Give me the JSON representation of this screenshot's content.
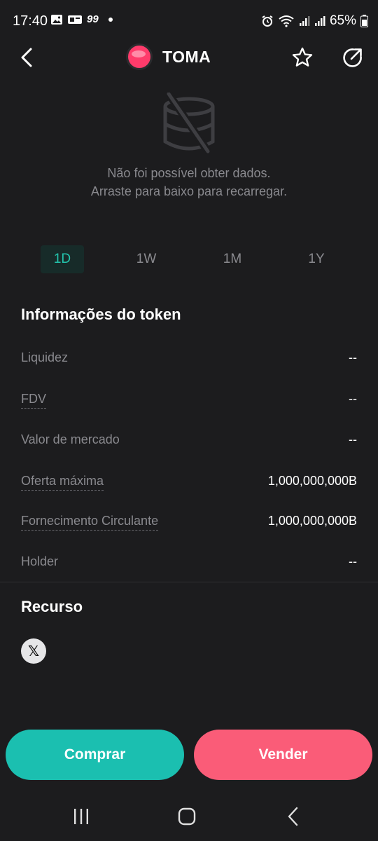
{
  "status_bar": {
    "time": "17:40",
    "badge": "99",
    "battery": "65%"
  },
  "header": {
    "token_name": "TOMA",
    "accent_color": "#ff3b6b"
  },
  "empty_state": {
    "line1": "Não foi possível obter dados.",
    "line2": "Arraste para baixo para recarregar."
  },
  "period_tabs": [
    {
      "label": "1D",
      "active": true
    },
    {
      "label": "1W",
      "active": false
    },
    {
      "label": "1M",
      "active": false
    },
    {
      "label": "1Y",
      "active": false
    }
  ],
  "token_info": {
    "title": "Informações do token",
    "rows": [
      {
        "label": "Liquidez",
        "value": "--"
      },
      {
        "label": "FDV",
        "value": "--"
      },
      {
        "label": "Valor de mercado",
        "value": "--"
      },
      {
        "label": "Oferta máxima",
        "value": "1,000,000,000B"
      },
      {
        "label": "Fornecimento Circulante",
        "value": "1,000,000,000B"
      },
      {
        "label": "Holder",
        "value": "--"
      }
    ]
  },
  "resources": {
    "title": "Recurso",
    "x_icon_glyph": "𝕏"
  },
  "actions": {
    "buy_label": "Comprar",
    "sell_label": "Vender",
    "buy_color": "#1bbfb0",
    "sell_color": "#fa5c78"
  }
}
